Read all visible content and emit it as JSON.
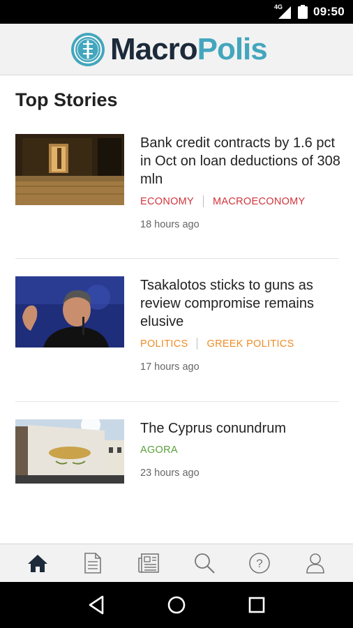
{
  "status_bar": {
    "network": "4G",
    "time": "09:50"
  },
  "header": {
    "logo_part1": "Macro",
    "logo_part2": "Polis",
    "colors": {
      "dark": "#1c2a3a",
      "accent": "#43a6bd"
    }
  },
  "section_title": "Top Stories",
  "stories": [
    {
      "headline": "Bank credit contracts by 1.6 pct in Oct on loan deductions of 308 mln",
      "categories": [
        "ECONOMY",
        "MACROECONOMY"
      ],
      "category_color": "#d0343c",
      "time": "18 hours ago",
      "thumbnail": "bank-entrance-night-photo"
    },
    {
      "headline": "Tsakalotos sticks to guns as review compromise remains elusive",
      "categories": [
        "POLITICS",
        "GREEK POLITICS"
      ],
      "category_color": "#ee8c26",
      "time": "17 hours ago",
      "thumbnail": "politician-speaking-photo"
    },
    {
      "headline": "The Cyprus conundrum",
      "categories": [
        "AGORA"
      ],
      "category_color": "#5aa13a",
      "time": "23 hours ago",
      "thumbnail": "cyprus-map-wall-photo"
    }
  ],
  "tabs": [
    {
      "name": "home-icon",
      "active": true
    },
    {
      "name": "document-icon",
      "active": false
    },
    {
      "name": "newspaper-icon",
      "active": false
    },
    {
      "name": "search-icon",
      "active": false
    },
    {
      "name": "help-icon",
      "active": false
    },
    {
      "name": "profile-icon",
      "active": false
    }
  ],
  "nav": [
    "back-icon",
    "home-circle-icon",
    "recents-icon"
  ]
}
